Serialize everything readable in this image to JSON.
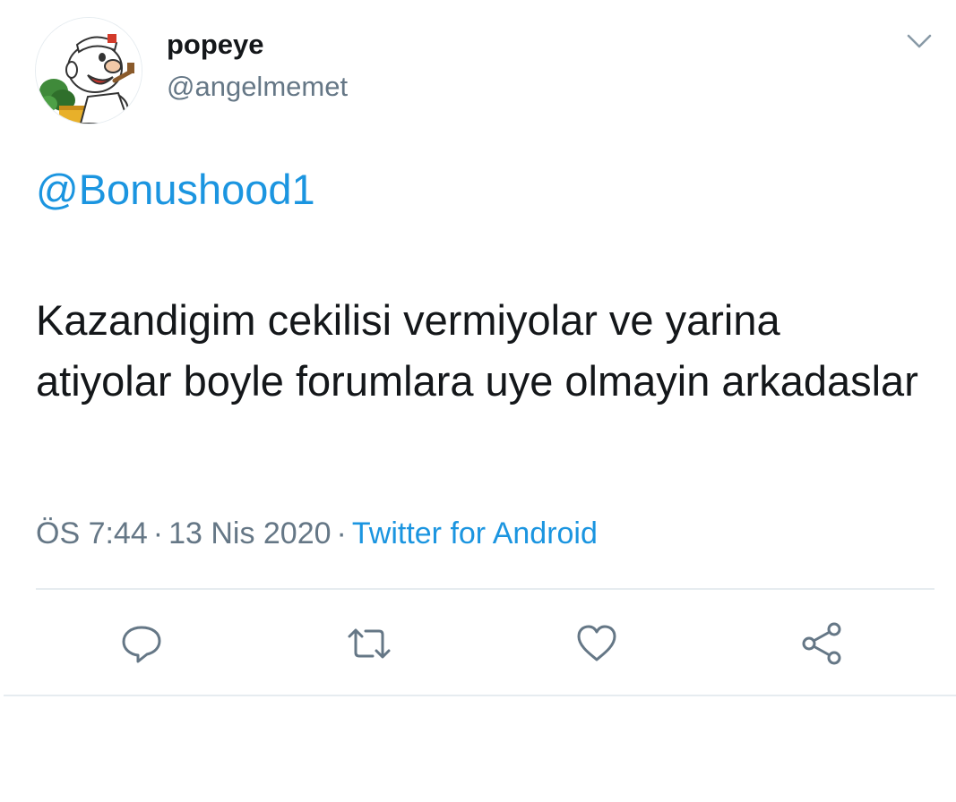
{
  "user": {
    "display_name": "popeye",
    "handle": "@angelmemet",
    "avatar": "popeye-cartoon-avatar"
  },
  "tweet": {
    "mention": "@Bonushood1",
    "text": "Kazandigim cekilisi vermiyolar ve yarina atiyolar boyle forumlara uye olmayin arkadaslar",
    "time": "ÖS 7:44",
    "date": "13 Nis 2020",
    "separator": "·",
    "source": "Twitter for Android"
  },
  "icons": {
    "menu": "chevron-down-icon",
    "reply": "reply-icon",
    "retweet": "retweet-icon",
    "like": "heart-icon",
    "share": "share-icon"
  },
  "colors": {
    "link": "#1b95e0",
    "secondary_text": "#657786",
    "primary_text": "#14171a",
    "divider": "#e6ecf0"
  }
}
